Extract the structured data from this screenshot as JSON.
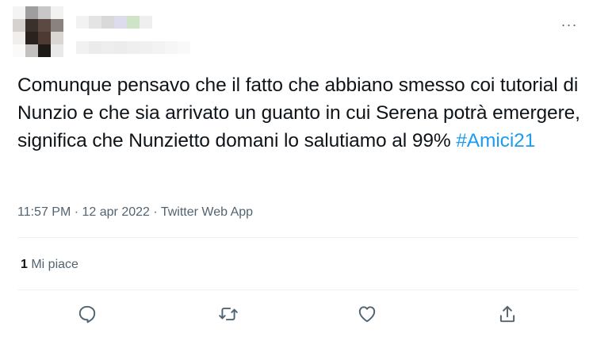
{
  "header": {
    "more_icon": "more-horizontal-icon",
    "more_label": "···"
  },
  "tweet": {
    "text": "Comunque pensavo che il fatto che abbiano smesso coi tutorial di Nunzio e che sia arrivato un guanto in cui Serena potrà emergere, significa che Nunzietto domani lo salutiamo al 99% ",
    "hashtag": "#Amici21"
  },
  "meta": {
    "time": "11:57 PM",
    "separator": " · ",
    "date": "12 apr 2022",
    "source": "Twitter Web App"
  },
  "stats": {
    "likes_count": "1",
    "likes_label": " Mi piace"
  },
  "actions": [
    {
      "name": "reply",
      "icon": "reply-icon"
    },
    {
      "name": "retweet",
      "icon": "retweet-icon"
    },
    {
      "name": "like",
      "icon": "heart-icon"
    },
    {
      "name": "share",
      "icon": "share-icon"
    }
  ],
  "colors": {
    "text": "#0f1419",
    "secondary": "#536471",
    "accent": "#1d9bf0",
    "divider": "#eff3f4"
  }
}
